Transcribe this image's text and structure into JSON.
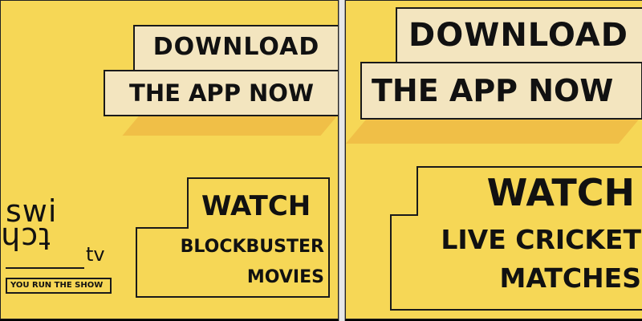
{
  "left_ad": {
    "headline_line1": "DOWNLOAD",
    "headline_line2": "THE APP NOW",
    "watch": "WATCH",
    "sub_line1": "BLOCKBUSTER",
    "sub_line2": "MOVIES",
    "logo": {
      "top": "swi",
      "bottom": "tch",
      "suffix": "tv",
      "tagline": "YOU RUN THE SHOW"
    }
  },
  "right_ad": {
    "headline_line1": "DOWNLOAD",
    "headline_line2": "THE APP NOW",
    "watch": "WATCH",
    "sub_line1": "LIVE CRICKET",
    "sub_line2": "MATCHES"
  },
  "colors": {
    "background": "#f6d756",
    "box_fill": "#f3e5bf",
    "shadow": "#f0bf47",
    "ink": "#111111"
  }
}
